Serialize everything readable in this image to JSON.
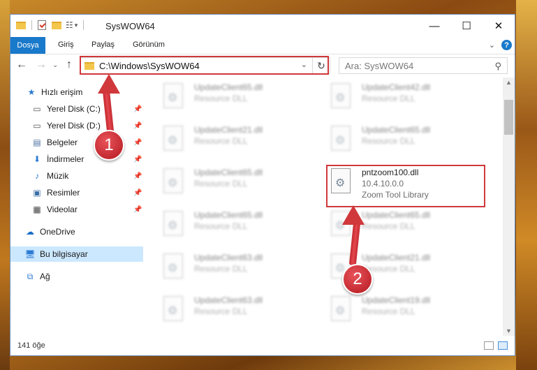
{
  "window": {
    "title": "SysWOW64",
    "controls": {
      "minimize": "—",
      "maximize": "☐",
      "close": "✕"
    }
  },
  "ribbon": {
    "tabs": [
      "Dosya",
      "Giriş",
      "Paylaş",
      "Görünüm"
    ],
    "help": "?"
  },
  "nav": {
    "address": "C:\\Windows\\SysWOW64",
    "search_placeholder": "Ara: SysWOW64"
  },
  "sidebar": {
    "items": [
      {
        "label": "Hızlı erişim",
        "icon": "star-icon"
      },
      {
        "label": "Yerel Disk (C:)",
        "icon": "drive-icon"
      },
      {
        "label": "Yerel Disk (D:)",
        "icon": "drive-icon"
      },
      {
        "label": "Belgeler",
        "icon": "documents-icon"
      },
      {
        "label": "İndirmeler",
        "icon": "download-icon"
      },
      {
        "label": "Müzik",
        "icon": "music-icon"
      },
      {
        "label": "Resimler",
        "icon": "pictures-icon"
      },
      {
        "label": "Videolar",
        "icon": "video-icon"
      },
      {
        "label": "OneDrive",
        "icon": "cloud-icon"
      },
      {
        "label": "Bu bilgisayar",
        "icon": "computer-icon"
      },
      {
        "label": "Ağ",
        "icon": "network-icon"
      }
    ]
  },
  "files": {
    "left": [
      {
        "name": "UpdateClient65.dll",
        "type": "Resource DLL"
      },
      {
        "name": "UpdateClient21.dll",
        "type": "Resource DLL"
      },
      {
        "name": "UpdateClient65.dll",
        "type": "Resource DLL"
      },
      {
        "name": "UpdateClient65.dll",
        "type": "Resource DLL"
      },
      {
        "name": "UpdateClient63.dll",
        "type": "Resource DLL"
      },
      {
        "name": "UpdateClient63.dll",
        "type": "Resource DLL"
      }
    ],
    "right": [
      {
        "name": "UpdateClient42.dll",
        "type": "Resource DLL"
      },
      {
        "name": "UpdateClient65.dll",
        "type": "Resource DLL"
      },
      {
        "name": "UpdateClient65.dll",
        "type": "Resource DLL"
      },
      {
        "name": "UpdateClient21.dll",
        "type": "Resource DLL"
      },
      {
        "name": "UpdateClient19.dll",
        "type": "Resource DLL"
      }
    ],
    "highlight": {
      "name": "pntzoom100.dll",
      "version": "10.4.10.0.0",
      "description": "Zoom Tool Library"
    }
  },
  "status": {
    "count": "141 öğe"
  },
  "callouts": {
    "one": "1",
    "two": "2"
  },
  "colors": {
    "accent": "#1979ca",
    "highlight": "#d0383b"
  }
}
